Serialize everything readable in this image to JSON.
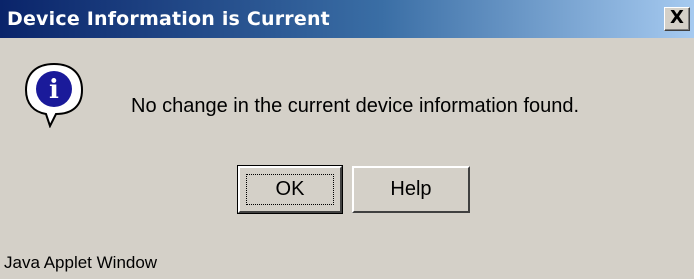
{
  "window": {
    "title": "Device Information is Current",
    "close_glyph": "X"
  },
  "icon": {
    "name": "info-icon",
    "glyph": "i",
    "color": "#1a1a9a"
  },
  "message": "No change in the current device information found.",
  "buttons": {
    "ok_label": "OK",
    "help_label": "Help"
  },
  "status_bar": "Java Applet Window",
  "colors": {
    "titlebar_start": "#0a246a",
    "titlebar_end": "#a6caf0",
    "dialog_bg": "#d4d0c8"
  }
}
